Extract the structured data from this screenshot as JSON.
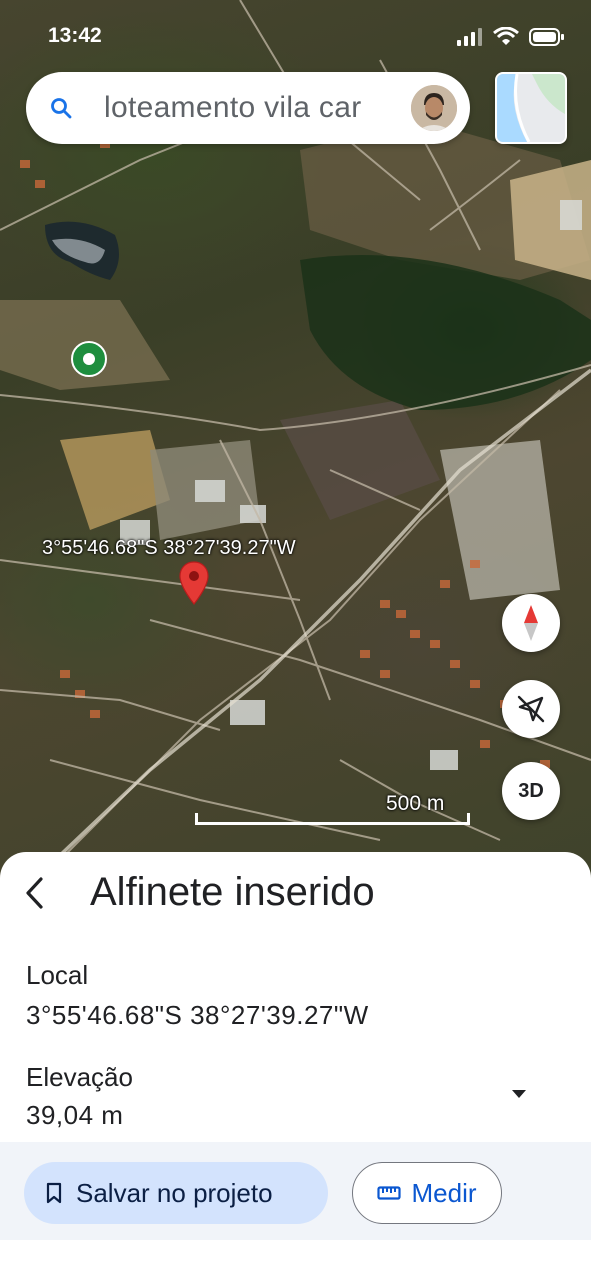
{
  "status_bar": {
    "time": "13:42"
  },
  "search": {
    "query": "loteamento vila car"
  },
  "map": {
    "pin_coordinates_label": "3°55'46.68\"S 38°27'39.27\"W",
    "scale_label": "500 m",
    "three_d_label": "3D"
  },
  "sheet": {
    "title": "Alfinete inserido",
    "location_label": "Local",
    "location_value": "3°55'46.68\"S 38°27'39.27\"W",
    "elevation_label": "Elevação",
    "elevation_value": "39,04 m"
  },
  "actions": {
    "save_label": "Salvar no projeto",
    "measure_label": "Medir"
  },
  "colors": {
    "pin": "#e53935",
    "save_button_bg": "#d3e3fd",
    "accent": "#0b57d0",
    "place_marker": "#1e8e3e"
  }
}
